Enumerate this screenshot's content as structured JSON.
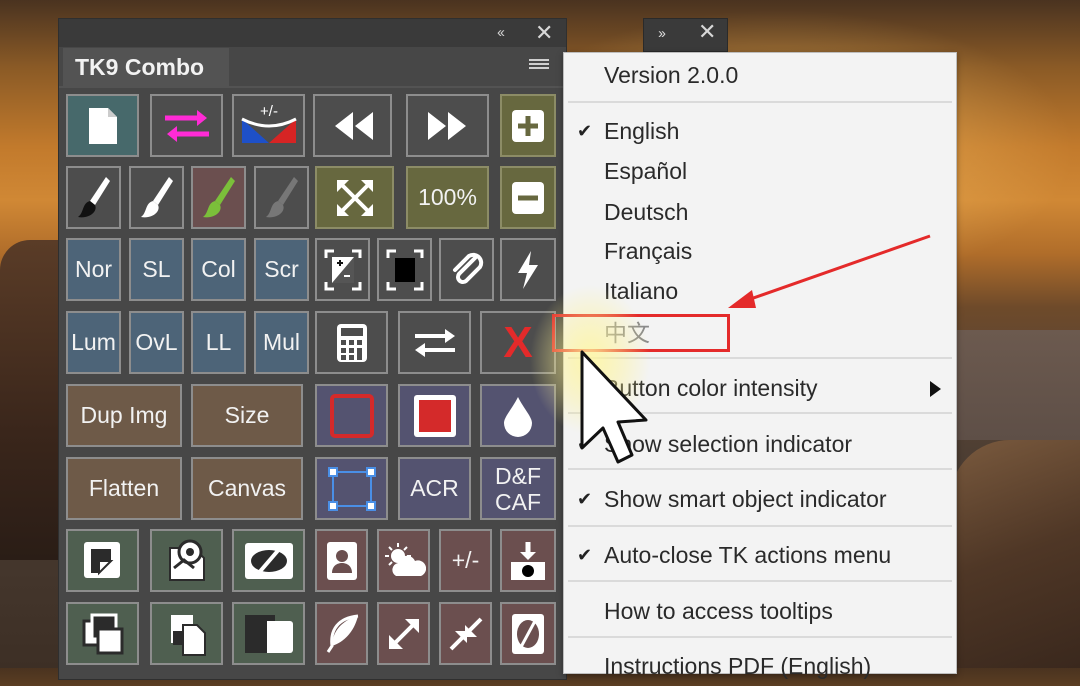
{
  "panel": {
    "title": "TK9 Combo",
    "collapse_glyph": "‹‹",
    "close_glyph": "✕",
    "buttons": {
      "zoom100": "100%",
      "plusminus": "+/-",
      "nor": "Nor",
      "sl": "SL",
      "col": "Col",
      "scr": "Scr",
      "lum": "Lum",
      "ovl": "OvL",
      "ll": "LL",
      "mul": "Mul",
      "x": "X",
      "dup_img": "Dup Img",
      "size": "Size",
      "flatten": "Flatten",
      "canvas": "Canvas",
      "acr": "ACR",
      "df_line1": "D&F",
      "df_line2": "CAF",
      "plusminus2": "+/-"
    }
  },
  "mini_panel": {
    "expand_glyph": "››",
    "close_glyph": "✕"
  },
  "menu": {
    "version": "Version 2.0.0",
    "languages": [
      {
        "label": "English",
        "checked": true
      },
      {
        "label": "Español",
        "checked": false
      },
      {
        "label": "Deutsch",
        "checked": false
      },
      {
        "label": "Français",
        "checked": false
      },
      {
        "label": "Italiano",
        "checked": false
      },
      {
        "label": "中文",
        "checked": false
      }
    ],
    "button_color_intensity": "Button color intensity",
    "show_selection_indicator": "Show selection indicator",
    "show_smart_object_indicator": "Show smart object indicator",
    "auto_close": "Auto-close TK actions menu",
    "tooltips": "How to access tooltips",
    "instructions": "Instructions PDF (English)"
  },
  "colors": {
    "highlight_red": "#e42a2a",
    "menu_bg": "#f3f3f3",
    "panel_bg": "#474747"
  }
}
